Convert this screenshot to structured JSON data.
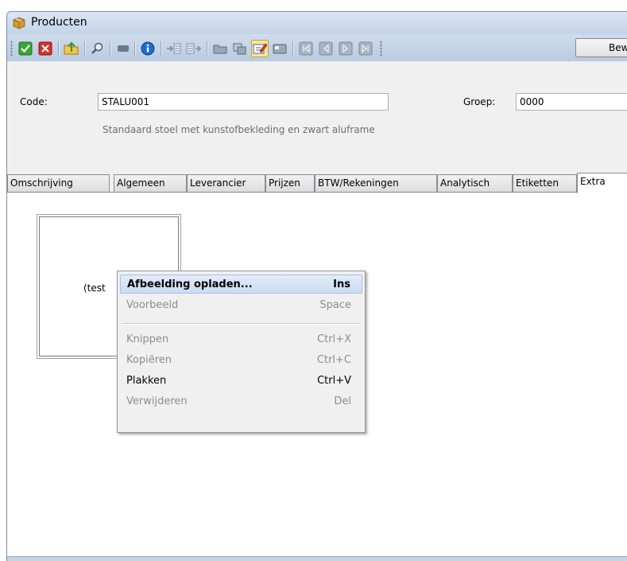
{
  "window": {
    "title": "Producten"
  },
  "toolbar": {
    "bew_button": "Bew"
  },
  "header": {
    "code_label": "Code:",
    "code_value": "STALU001",
    "group_label": "Groep:",
    "group_value": "0000",
    "description": "Standaard stoel met kunstofbekleding en zwart aluframe"
  },
  "tabs": [
    {
      "label": "Omschrijving"
    },
    {
      "label": "Algemeen"
    },
    {
      "label": "Leverancier"
    },
    {
      "label": "Prijzen"
    },
    {
      "label": "BTW/Rekeningen"
    },
    {
      "label": "Analytisch"
    },
    {
      "label": "Etiketten"
    },
    {
      "label": "Extra"
    }
  ],
  "image_box": {
    "text": "(test"
  },
  "context_menu": {
    "items": [
      {
        "label": "Afbeelding opladen...",
        "shortcut": "Ins",
        "state": "highlighted"
      },
      {
        "label": "Voorbeeld",
        "shortcut": "Space",
        "state": "disabled"
      },
      {
        "label": "Knippen",
        "shortcut": "Ctrl+X",
        "state": "disabled"
      },
      {
        "label": "Kopiëren",
        "shortcut": "Ctrl+C",
        "state": "disabled"
      },
      {
        "label": "Plakken",
        "shortcut": "Ctrl+V",
        "state": "enabled"
      },
      {
        "label": "Verwijderen",
        "shortcut": "Del",
        "state": "disabled"
      }
    ]
  },
  "icons": [
    "package-icon",
    "save-check-icon",
    "cancel-x-icon",
    "folder-up-icon",
    "search-icon",
    "stop-icon",
    "info-icon",
    "insert-icon",
    "append-icon",
    "folder-icon",
    "copy-icon",
    "edit-icon",
    "card-icon",
    "first-icon",
    "prev-icon",
    "next-icon",
    "last-icon"
  ],
  "colors": {
    "accent": "#1e6ec8",
    "highlight": "#c9dbf3",
    "titlebar": "#c3d4e8"
  }
}
